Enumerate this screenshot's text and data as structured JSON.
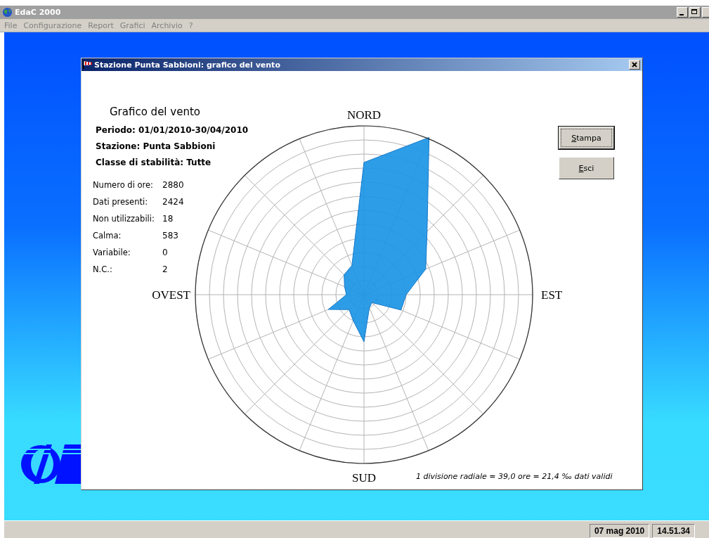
{
  "app": {
    "title": "EdaC 2000",
    "menu": [
      "File",
      "Configurazione",
      "Report",
      "Grafici",
      "Archivio",
      "?"
    ]
  },
  "dialog": {
    "title": "Stazione Punta Sabbioni: grafico del vento",
    "heading": "Grafico del vento",
    "details": [
      "Periodo: 01/01/2010-30/04/2010",
      "Stazione: Punta Sabbioni",
      "Classe di stabilità: Tutte"
    ],
    "stats": [
      {
        "label": "Numero di ore:",
        "value": "2880"
      },
      {
        "label": "Dati presenti:",
        "value": "2424"
      },
      {
        "label": "Non utilizzabili:",
        "value": "18"
      },
      {
        "label": "Calma:",
        "value": "583"
      },
      {
        "label": "Variabile:",
        "value": "0"
      },
      {
        "label": "N.C.:",
        "value": "2"
      }
    ],
    "compass": {
      "north": "NORD",
      "east": "EST",
      "south": "SUD",
      "west": "OVEST"
    },
    "buttons": [
      {
        "accel": "S",
        "rest": "tampa",
        "focused": true
      },
      {
        "accel": "E",
        "rest": "sci",
        "focused": false
      }
    ],
    "note": "1 divisione radiale = 39,0 ore = 21,4 ‰ dati validi"
  },
  "status_bar": [
    "07 mag 2010",
    "14.51.34"
  ]
}
